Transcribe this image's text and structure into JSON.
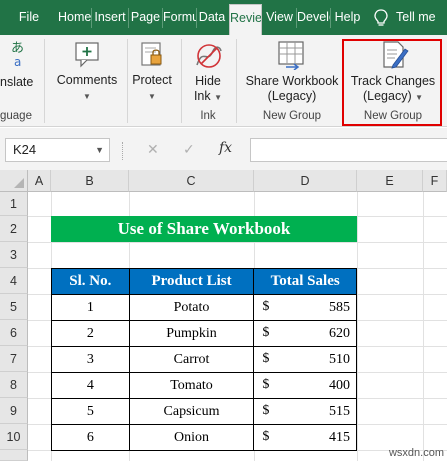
{
  "tabs": [
    "File",
    "Home",
    "Insert",
    "Page",
    "Formulas",
    "Data",
    "Review",
    "View",
    "Developer",
    "Help",
    "Tell me"
  ],
  "ribbon": {
    "translate": "nslate",
    "language_group": "guage",
    "comments": "Comments",
    "protect": "Protect",
    "hide_ink_line1": "Hide",
    "hide_ink_line2": "Ink",
    "ink_group": "Ink",
    "share_line1": "Share Workbook",
    "share_line2": "(Legacy)",
    "new_group_1": "New Group",
    "track_line1": "Track Changes",
    "track_line2": "(Legacy)",
    "new_group_2": "New Group"
  },
  "formula_bar": {
    "name_box": "K24",
    "fx_label": "fx",
    "formula": ""
  },
  "columns": [
    "A",
    "B",
    "C",
    "D",
    "E",
    "F"
  ],
  "rows": [
    "1",
    "2",
    "3",
    "4",
    "5",
    "6",
    "7",
    "8",
    "9",
    "10"
  ],
  "sheet": {
    "title": "Use of Share Workbook",
    "headers": [
      "Sl. No.",
      "Product List",
      "Total Sales"
    ],
    "currency": "$",
    "rows": [
      {
        "no": "1",
        "product": "Potato",
        "sales": "585"
      },
      {
        "no": "2",
        "product": "Pumpkin",
        "sales": "620"
      },
      {
        "no": "3",
        "product": "Carrot",
        "sales": "510"
      },
      {
        "no": "4",
        "product": "Tomato",
        "sales": "400"
      },
      {
        "no": "5",
        "product": "Capsicum",
        "sales": "515"
      },
      {
        "no": "6",
        "product": "Onion",
        "sales": "415"
      }
    ]
  },
  "watermark": "wsxdn.com",
  "colors": {
    "excel_green": "#217346",
    "title_fill": "#00b050",
    "header_fill": "#0070c0",
    "highlight": "#e00000"
  }
}
